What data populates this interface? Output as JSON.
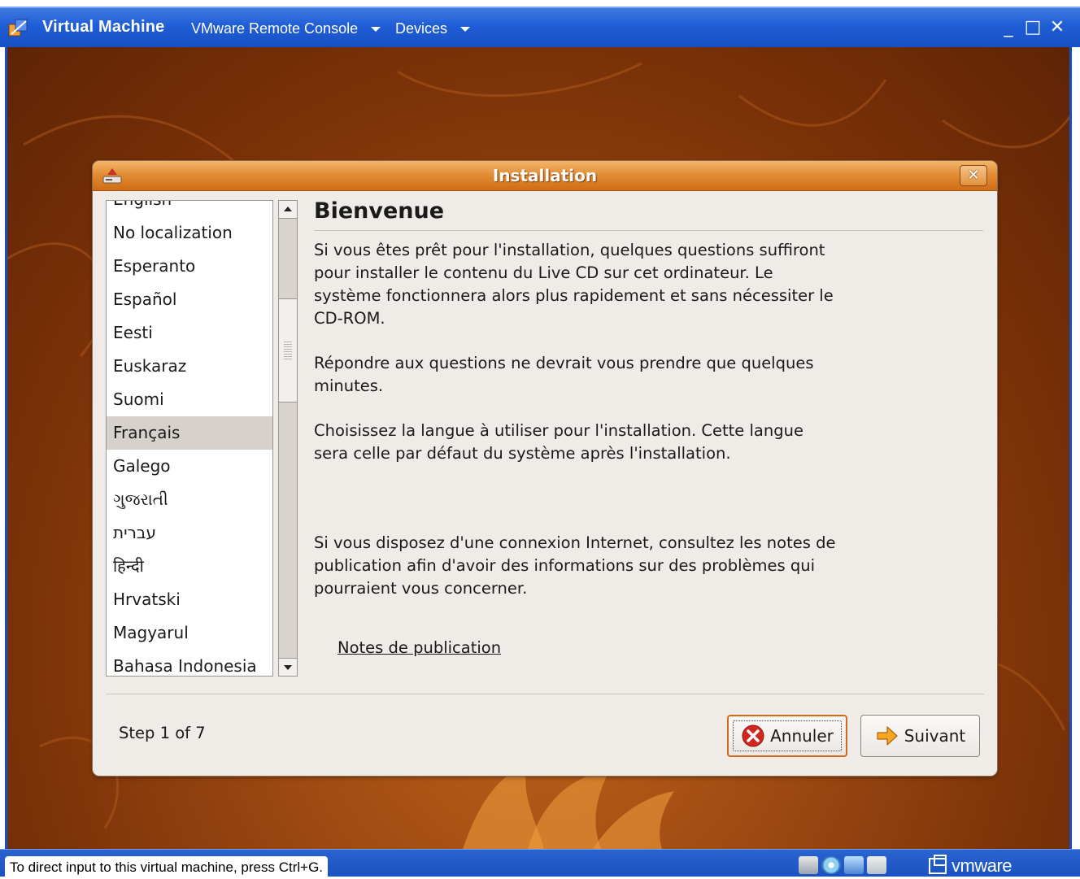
{
  "host": {
    "app_title": "Virtual Machine",
    "menus": [
      {
        "label": "VMware Remote Console"
      },
      {
        "label": "Devices"
      }
    ],
    "window_controls": {
      "minimize": "_",
      "maximize": "□",
      "close": "✕"
    },
    "status_text": "To direct input to this virtual machine, press Ctrl+G.",
    "brand": "vmware",
    "status_icons": [
      "hard-disk-icon",
      "cd-rom-icon",
      "network-icon",
      "keyboard-icon"
    ]
  },
  "dialog": {
    "title": "Installation",
    "close_glyph": "✕",
    "languages": [
      {
        "label": "English",
        "selected": false
      },
      {
        "label": "No localization",
        "selected": false
      },
      {
        "label": "Esperanto",
        "selected": false
      },
      {
        "label": "Español",
        "selected": false
      },
      {
        "label": "Eesti",
        "selected": false
      },
      {
        "label": "Euskaraz",
        "selected": false
      },
      {
        "label": "Suomi",
        "selected": false
      },
      {
        "label": "Français",
        "selected": true
      },
      {
        "label": "Galego",
        "selected": false
      },
      {
        "label": "ગુજરાતી",
        "selected": false
      },
      {
        "label": "עברית",
        "selected": false
      },
      {
        "label": "हिन्दी",
        "selected": false
      },
      {
        "label": "Hrvatski",
        "selected": false
      },
      {
        "label": "Magyarul",
        "selected": false
      },
      {
        "label": "Bahasa Indonesia",
        "selected": false
      }
    ],
    "heading": "Bienvenue",
    "paragraph1": "Si vous êtes prêt pour l'installation, quelques questions suffiront pour installer le contenu du Live CD sur cet ordinateur. Le système fonctionnera alors plus rapidement et sans nécessiter le CD-ROM.",
    "paragraph2": "Répondre aux questions ne devrait vous prendre que quelques minutes.",
    "paragraph3": "Choisissez la langue à utiliser pour l'installation. Cette langue sera celle par défaut du système après l'installation.",
    "paragraph4": "Si vous disposez d'une connexion Internet, consultez les notes de publication afin d'avoir des informations sur des problèmes qui pourraient vous concerner.",
    "release_notes_link": "Notes de publication",
    "step": "Step 1 of 7",
    "cancel_label": "Annuler",
    "next_label": "Suivant"
  },
  "colors": {
    "host_titlebar": "#1f5dd6",
    "dialog_titlebar": "#e08a32",
    "desktop": "#9e4a12",
    "selection": "#d7d1cb"
  }
}
